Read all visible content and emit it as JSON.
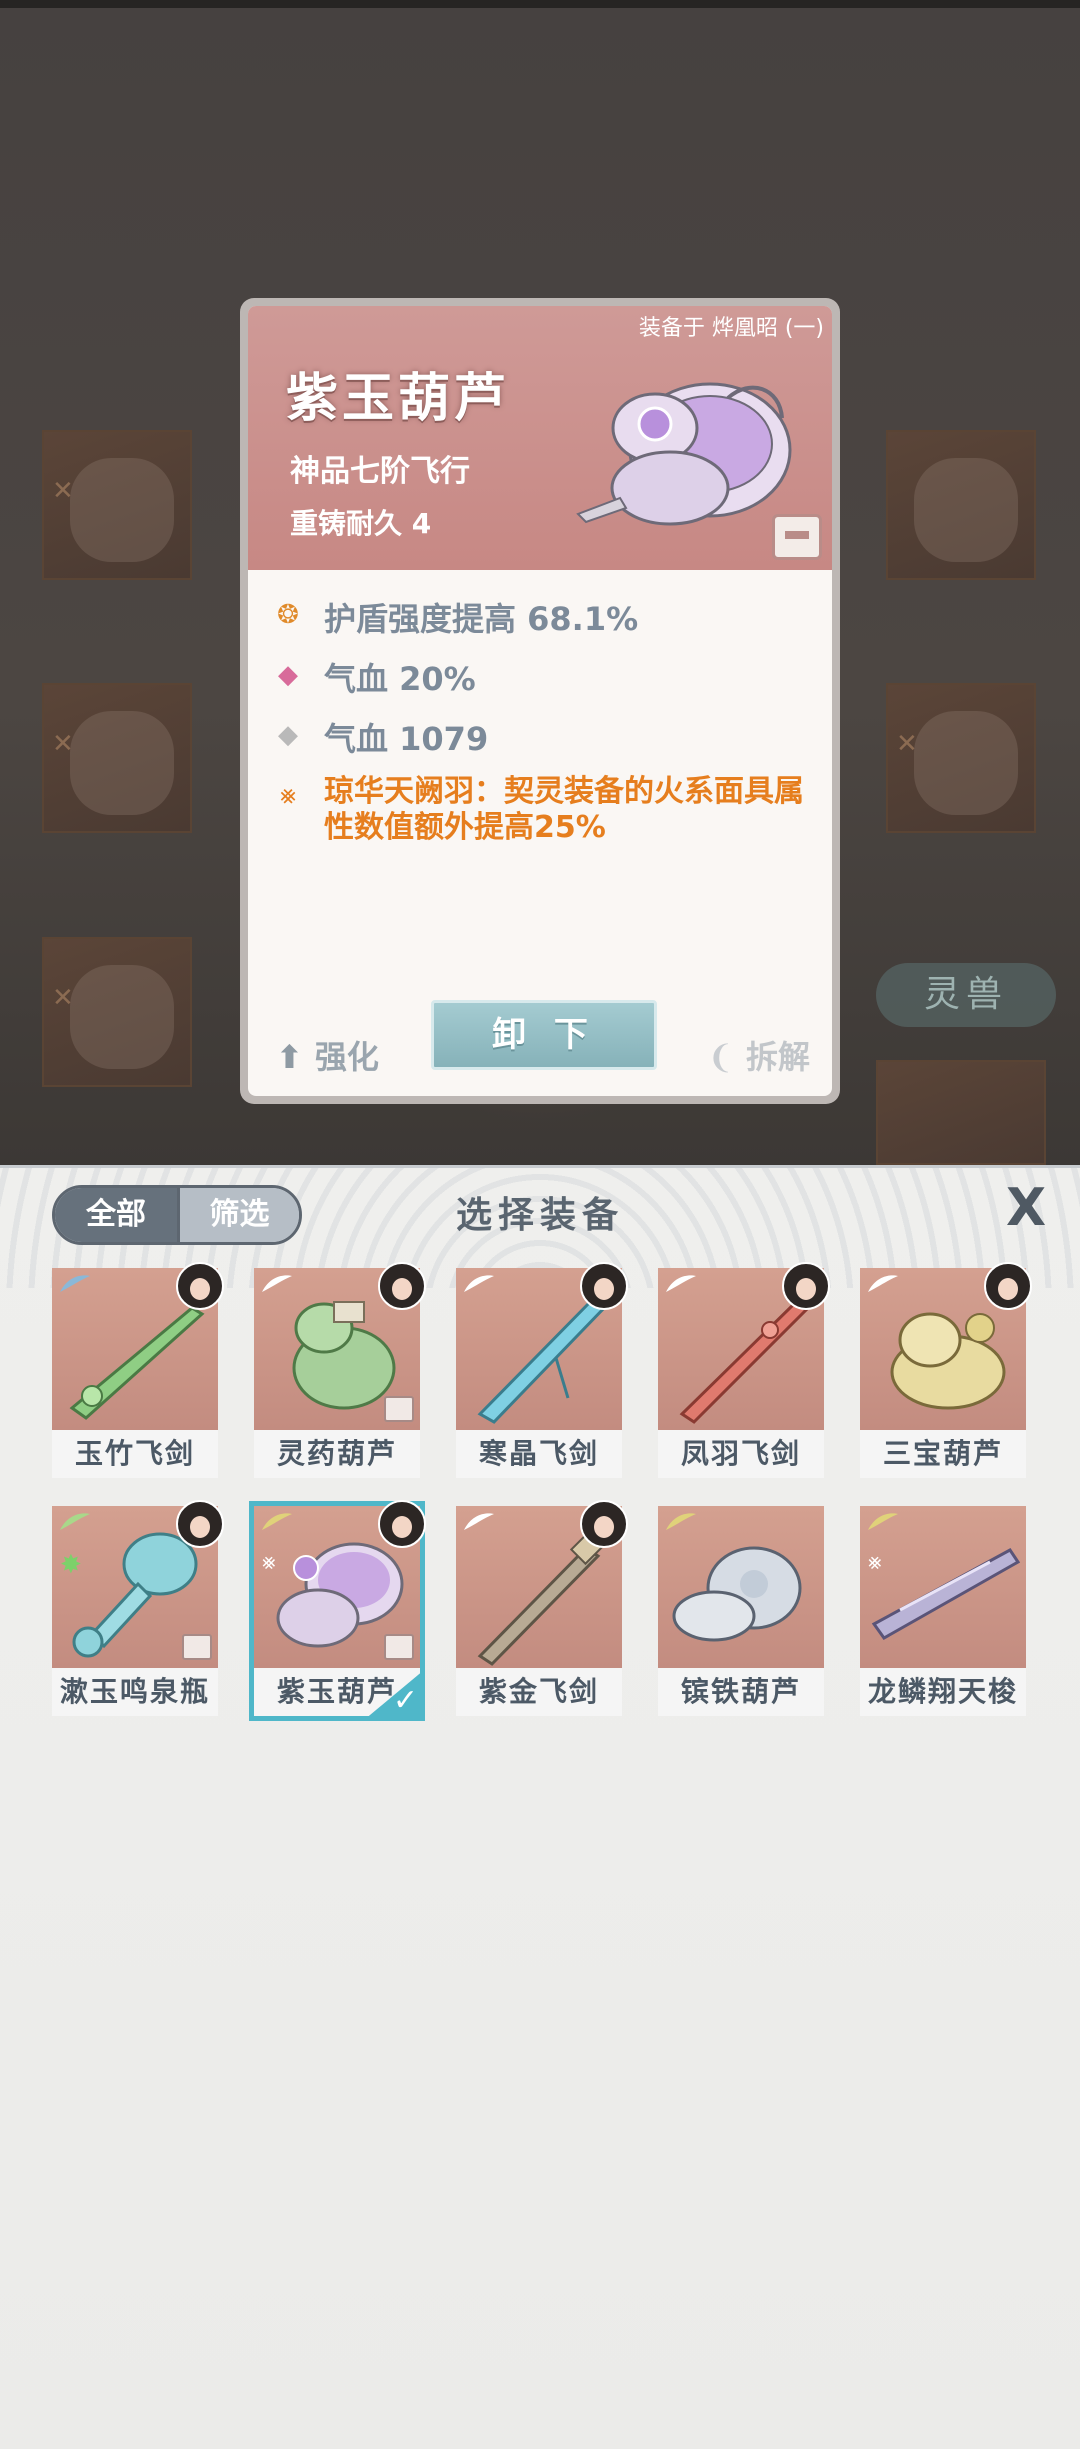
{
  "card": {
    "equipped_on": "装备于 烨凰昭 (一)",
    "name": "紫玉葫芦",
    "grade": "神品七阶飞行",
    "durability": "重铸耐久 4",
    "stats": [
      {
        "icon": "flame-icon",
        "text": "护盾强度提高 68.1%",
        "color": "#e08a2a"
      },
      {
        "icon": "diamond-pink-icon",
        "text": "气血 20%",
        "color": "#d86b9a"
      },
      {
        "icon": "diamond-grey-icon",
        "text": "气血 1079",
        "color": "#b9b9b9"
      },
      {
        "icon": "rune-icon",
        "text": "琼华天阙羽：契灵装备的火系面具属性数值额外提高25%",
        "color": "#e67e1e"
      }
    ],
    "enhance_label": "强化",
    "unequip_label": "卸 下",
    "disassemble_label": "拆解"
  },
  "side_label": "灵兽",
  "panel": {
    "tab_all": "全部",
    "tab_filter": "筛选",
    "title": "选择装备",
    "close": "X",
    "items": [
      {
        "name": "玉竹飞剑",
        "wing": "#8ab8d8",
        "art": "sword-green"
      },
      {
        "name": "灵药葫芦",
        "wing": "#ffffff",
        "art": "gourd-green"
      },
      {
        "name": "寒晶飞剑",
        "wing": "#ffffff",
        "art": "sword-blue"
      },
      {
        "name": "凤羽飞剑",
        "wing": "#ffffff",
        "art": "sword-red"
      },
      {
        "name": "三宝葫芦",
        "wing": "#ffffff",
        "art": "gourd-gold"
      },
      {
        "name": "漱玉鸣泉瓶",
        "wing": "#a9d88a",
        "art": "bottle-teal"
      },
      {
        "name": "紫玉葫芦",
        "wing": "#e0d27a",
        "art": "gourd-purple"
      },
      {
        "name": "紫金飞剑",
        "wing": "#ffffff",
        "art": "sword-bronze"
      },
      {
        "name": "镔铁葫芦",
        "wing": "#e0d27a",
        "art": "gourd-silver"
      },
      {
        "name": "龙鳞翔天梭",
        "wing": "#e0d27a",
        "art": "shuttle-purple"
      }
    ]
  }
}
